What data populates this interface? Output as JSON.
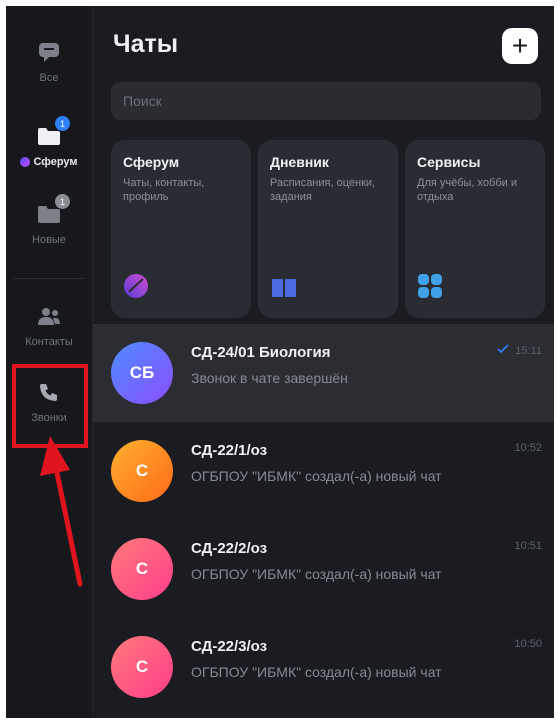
{
  "sidebar": {
    "items": [
      {
        "label": "Все",
        "badge": ""
      },
      {
        "label": "Сферум",
        "badge": "1"
      },
      {
        "label": "Новые",
        "badge": "1"
      },
      {
        "label": "Контакты",
        "badge": ""
      },
      {
        "label": "Звонки",
        "badge": ""
      }
    ]
  },
  "header": {
    "title": "Чаты",
    "new_button": "+"
  },
  "search": {
    "placeholder": "Поиск"
  },
  "cards": [
    {
      "title": "Сферум",
      "subtitle": "Чаты, контакты, профиль"
    },
    {
      "title": "Дневник",
      "subtitle": "Расписания, оценки, задания"
    },
    {
      "title": "Сервисы",
      "subtitle": "Для учёбы, хобби и отдыха"
    }
  ],
  "chats": [
    {
      "initials": "СБ",
      "name": "СД-24/01 Биология",
      "preview": "Звонок в чате завершён",
      "time": "15:11",
      "read": true,
      "avatar_color": "#6c63ff"
    },
    {
      "initials": "С",
      "name": "СД-22/1/оз",
      "preview": "ОГБПОУ \"ИБМК\" создал(-а) новый чат",
      "time": "10:52",
      "read": false,
      "avatar_color": "#ff8a20"
    },
    {
      "initials": "С",
      "name": "СД-22/2/оз",
      "preview": "ОГБПОУ \"ИБМК\" создал(-а) новый чат",
      "time": "10:51",
      "read": false,
      "avatar_color": "#ff4d79"
    },
    {
      "initials": "С",
      "name": "СД-22/3/оз",
      "preview": "ОГБПОУ \"ИБМК\" создал(-а) новый чат",
      "time": "10:50",
      "read": false,
      "avatar_color": "#ff4d79"
    }
  ],
  "colors": {
    "accent": "#2f80ff",
    "annotation": "#e0141e"
  }
}
